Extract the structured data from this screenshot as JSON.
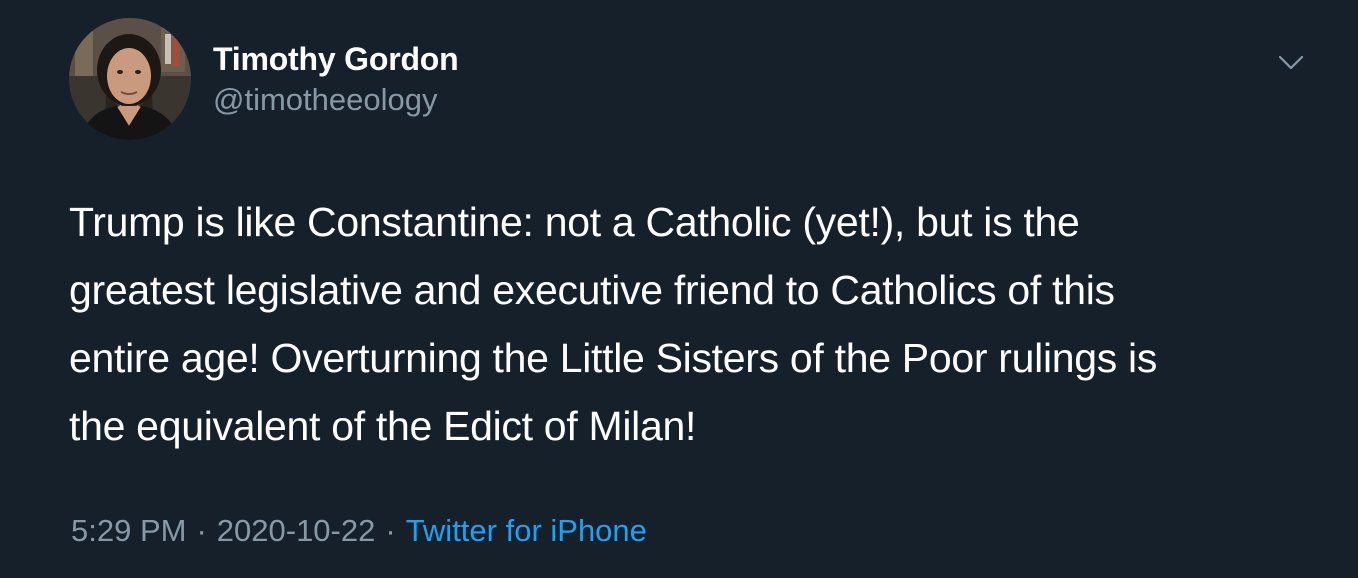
{
  "author": {
    "name": "Timothy Gordon",
    "handle": "@timotheeology"
  },
  "tweet": {
    "text": "Trump is like Constantine: not a Catholic (yet!), but is the\ngreatest legislative and executive friend to Catholics of this\nentire age!  Overturning the Little Sisters of the Poor rulings is\nthe equivalent of the Edict of Milan!"
  },
  "meta": {
    "time": "5:29 PM",
    "separator": "·",
    "date": "2020-10-22",
    "source": "Twitter for iPhone"
  },
  "icons": {
    "menu": "chevron-down-icon",
    "avatar": "profile-photo"
  },
  "colors": {
    "background": "#15202b",
    "primary_text": "#ffffff",
    "secondary_text": "#8899a6",
    "link": "#1da1f2"
  }
}
